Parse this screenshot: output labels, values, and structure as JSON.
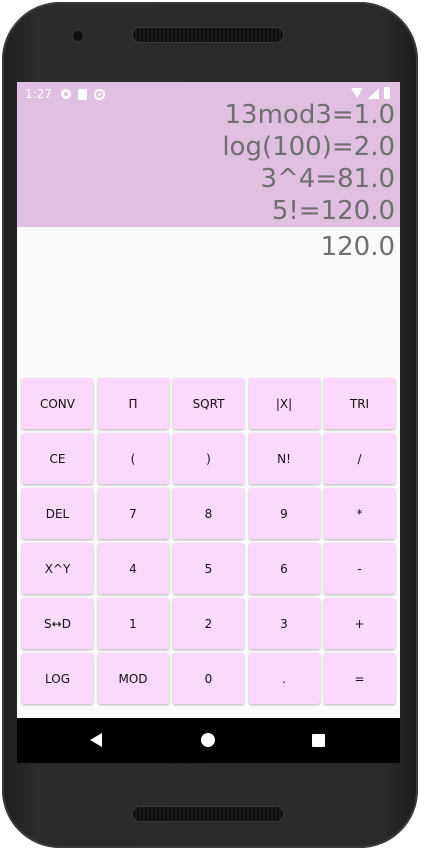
{
  "status_bar": {
    "time": "1:27",
    "left_icons": [
      "settings-icon",
      "sd-card-icon",
      "sync-icon"
    ],
    "right_icons": [
      "wifi-icon",
      "signal-icon",
      "battery-icon"
    ]
  },
  "history": {
    "lines": [
      "13mod3=1.0",
      "log(100)=2.0",
      "3^4=81.0",
      "5!=120.0"
    ],
    "background": "#e0bfe0"
  },
  "display": {
    "result": "120.0"
  },
  "keypad": {
    "key_color": "#fbd9fb",
    "rows": [
      [
        "CONV",
        "Π",
        "SQRT",
        "|X|",
        "TRI"
      ],
      [
        "CE",
        "(",
        ")",
        "N!",
        "/"
      ],
      [
        "DEL",
        "7",
        "8",
        "9",
        "*"
      ],
      [
        "X^Y",
        "4",
        "5",
        "6",
        "-"
      ],
      [
        "S↔D",
        "1",
        "2",
        "3",
        "+"
      ],
      [
        "LOG",
        "MOD",
        "0",
        ".",
        "="
      ]
    ]
  },
  "navigation_bar": {
    "buttons": [
      "back-icon",
      "home-icon",
      "recents-icon"
    ]
  }
}
